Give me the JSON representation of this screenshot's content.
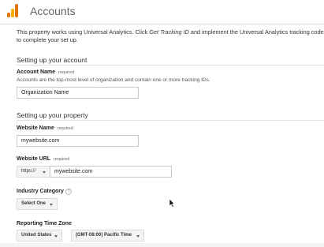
{
  "header": {
    "title": "Accounts",
    "logo_icon": "analytics-logo-icon"
  },
  "intro": {
    "part1": "This property works using Universal Analytics. Click ",
    "link_text": "Get Tracking ID",
    "part2": " and implement the Universal Analytics tracking code s",
    "line2": "to complete your set up."
  },
  "account_section": {
    "title": "Setting up your account",
    "account_name_label": "Account Name",
    "required_text": "required",
    "account_name_help": "Accounts are the top-most level of organization and contain one or more tracking IDs.",
    "account_name_value": "Organization Name"
  },
  "property_section": {
    "title": "Setting up your property",
    "website_name_label": "Website Name",
    "required_text": "required",
    "website_name_value": "mywebsite.com",
    "website_url_label": "Website URL",
    "protocol_value": "https://",
    "website_url_value": "mywebsite.com",
    "industry_label": "Industry Category",
    "industry_value": "Select One",
    "timezone_label": "Reporting Time Zone",
    "country_value": "United States",
    "timezone_value": "(GMT-08:00) Pacific Time"
  },
  "icons": {
    "help": "help-icon",
    "cursor": "mouse-cursor-icon",
    "dropdown": "chevron-down-icon"
  },
  "colors": {
    "brand_orange": "#e37400",
    "brand_yellow": "#f9ab00"
  }
}
